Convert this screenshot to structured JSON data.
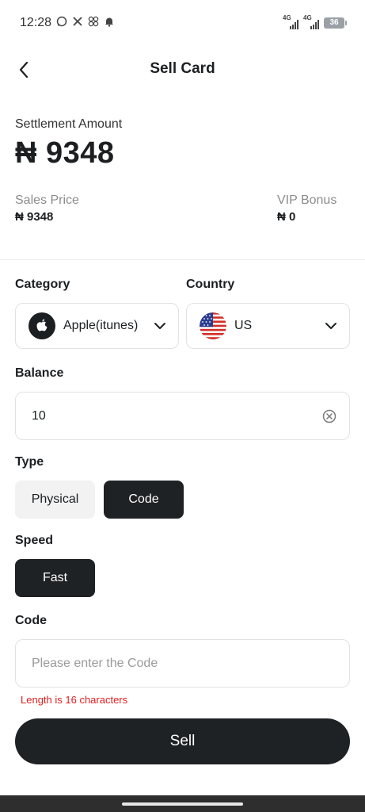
{
  "status_bar": {
    "time": "12:28",
    "icons": [
      "whatsapp-icon",
      "x-icon",
      "pinwheel-icon",
      "bell-icon"
    ],
    "network_1": "4G",
    "network_2": "4G",
    "battery": "36"
  },
  "header": {
    "title": "Sell Card",
    "back_icon": "chevron-left-icon"
  },
  "settlement": {
    "label": "Settlement Amount",
    "amount": "₦ 9348"
  },
  "sales_price": {
    "label": "Sales Price",
    "value": "₦ 9348"
  },
  "vip_bonus": {
    "label": "VIP Bonus",
    "value": "₦ 0"
  },
  "category": {
    "label": "Category",
    "selected": "Apple(itunes)",
    "icon": "apple-icon"
  },
  "country": {
    "label": "Country",
    "selected": "US",
    "icon": "us-flag-icon"
  },
  "balance": {
    "label": "Balance",
    "value": "10"
  },
  "type": {
    "label": "Type",
    "options": [
      "Physical",
      "Code"
    ],
    "selected": "Code"
  },
  "speed": {
    "label": "Speed",
    "options": [
      "Fast"
    ],
    "selected": "Fast"
  },
  "code": {
    "label": "Code",
    "placeholder": "Please enter the Code",
    "value": "",
    "hint": "Length is 16 characters"
  },
  "actions": {
    "sell_label": "Sell"
  },
  "colors": {
    "primary": "#1f2225",
    "error": "#e02020",
    "muted": "#8c8c8c",
    "border": "#e2e2e2"
  }
}
